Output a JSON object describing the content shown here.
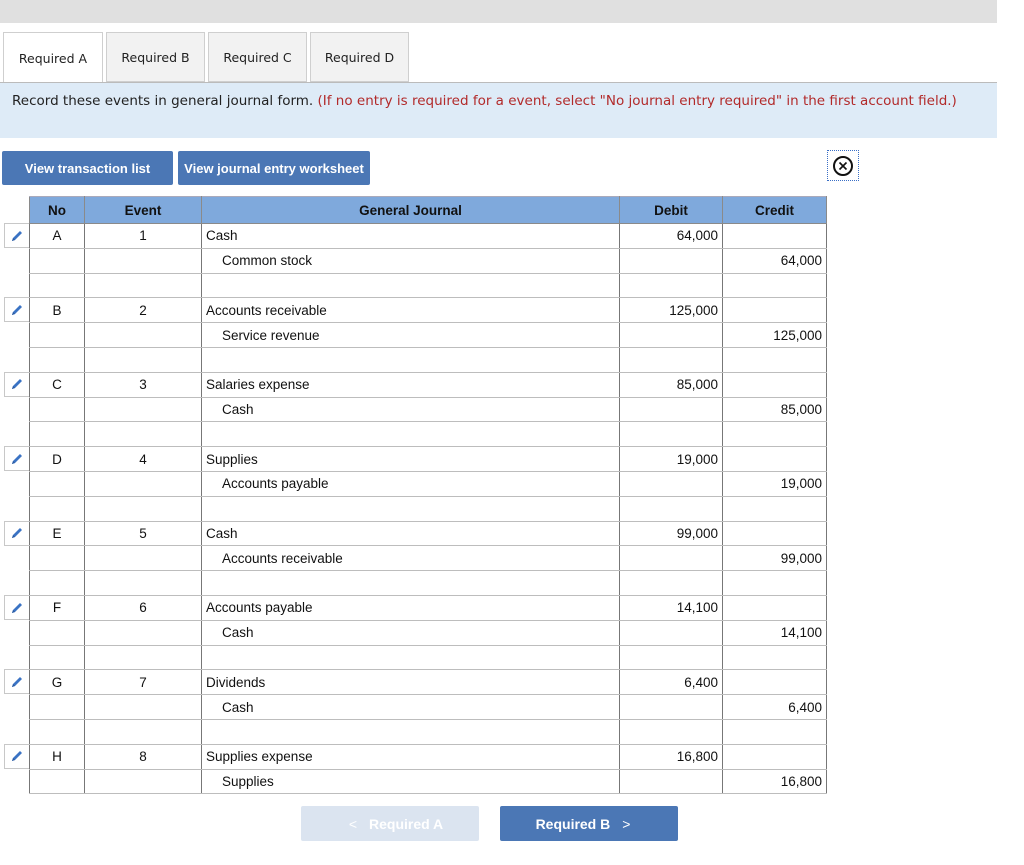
{
  "tabs": [
    {
      "label": "Required A",
      "active": true
    },
    {
      "label": "Required B",
      "active": false
    },
    {
      "label": "Required C",
      "active": false
    },
    {
      "label": "Required D",
      "active": false
    }
  ],
  "instruction": {
    "text": "Record these events in general journal form.",
    "note": "(If no entry is required for a event, select \"No journal entry required\" in the first account field.)"
  },
  "buttons": {
    "view_transaction_list": "View transaction list",
    "view_journal_worksheet": "View journal entry worksheet"
  },
  "close_icon": "circle-x-icon",
  "table": {
    "headers": [
      "No",
      "Event",
      "General Journal",
      "Debit",
      "Credit"
    ],
    "entries": [
      {
        "no": "A",
        "event": "1",
        "lines": [
          {
            "account": "Cash",
            "debit": "64,000",
            "credit": ""
          },
          {
            "account": "Common stock",
            "debit": "",
            "credit": "64,000"
          }
        ]
      },
      {
        "no": "B",
        "event": "2",
        "lines": [
          {
            "account": "Accounts receivable",
            "debit": "125,000",
            "credit": ""
          },
          {
            "account": "Service revenue",
            "debit": "",
            "credit": "125,000"
          }
        ]
      },
      {
        "no": "C",
        "event": "3",
        "lines": [
          {
            "account": "Salaries expense",
            "debit": "85,000",
            "credit": ""
          },
          {
            "account": "Cash",
            "debit": "",
            "credit": "85,000"
          }
        ]
      },
      {
        "no": "D",
        "event": "4",
        "lines": [
          {
            "account": "Supplies",
            "debit": "19,000",
            "credit": ""
          },
          {
            "account": "Accounts payable",
            "debit": "",
            "credit": "19,000"
          }
        ]
      },
      {
        "no": "E",
        "event": "5",
        "lines": [
          {
            "account": "Cash",
            "debit": "99,000",
            "credit": ""
          },
          {
            "account": "Accounts receivable",
            "debit": "",
            "credit": "99,000"
          }
        ]
      },
      {
        "no": "F",
        "event": "6",
        "lines": [
          {
            "account": "Accounts payable",
            "debit": "14,100",
            "credit": ""
          },
          {
            "account": "Cash",
            "debit": "",
            "credit": "14,100"
          }
        ]
      },
      {
        "no": "G",
        "event": "7",
        "lines": [
          {
            "account": "Dividends",
            "debit": "6,400",
            "credit": ""
          },
          {
            "account": "Cash",
            "debit": "",
            "credit": "6,400"
          }
        ]
      },
      {
        "no": "H",
        "event": "8",
        "lines": [
          {
            "account": "Supplies expense",
            "debit": "16,800",
            "credit": ""
          },
          {
            "account": "Supplies",
            "debit": "",
            "credit": "16,800"
          }
        ]
      }
    ]
  },
  "nav": {
    "prev_label": "Required A",
    "next_label": "Required B",
    "prev_icon": "<",
    "next_icon": ">"
  }
}
